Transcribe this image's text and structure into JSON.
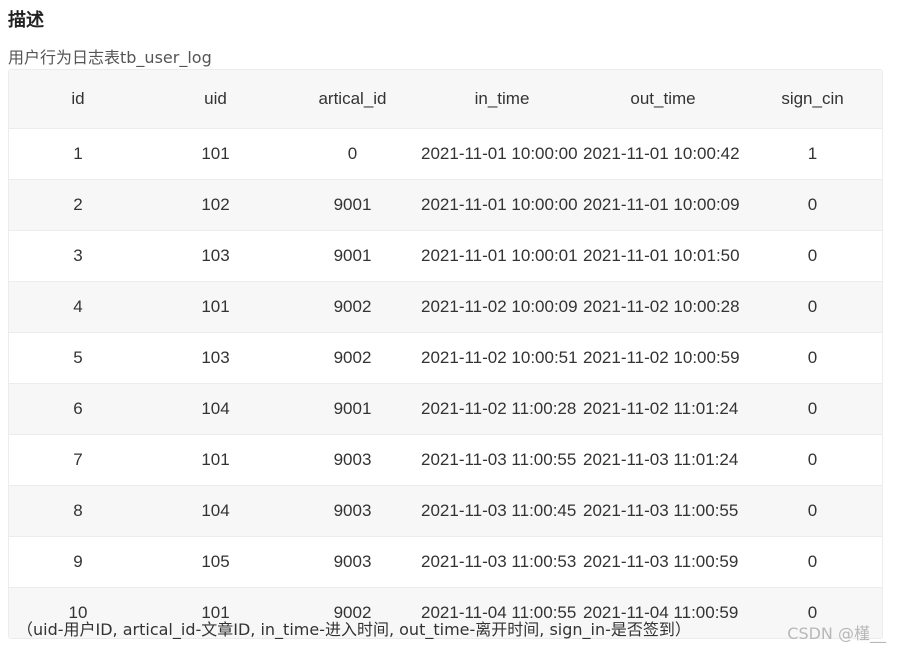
{
  "heading": "描述",
  "subtitle": "用户行为日志表tb_user_log",
  "table": {
    "columns": [
      "id",
      "uid",
      "artical_id",
      "in_time",
      "out_time",
      "sign_cin"
    ],
    "rows": [
      [
        "1",
        "101",
        "0",
        "2021-11-01 10:00:00",
        "2021-11-01 10:00:42",
        "1"
      ],
      [
        "2",
        "102",
        "9001",
        "2021-11-01 10:00:00",
        "2021-11-01 10:00:09",
        "0"
      ],
      [
        "3",
        "103",
        "9001",
        "2021-11-01 10:00:01",
        "2021-11-01 10:01:50",
        "0"
      ],
      [
        "4",
        "101",
        "9002",
        "2021-11-02 10:00:09",
        "2021-11-02 10:00:28",
        "0"
      ],
      [
        "5",
        "103",
        "9002",
        "2021-11-02 10:00:51",
        "2021-11-02 10:00:59",
        "0"
      ],
      [
        "6",
        "104",
        "9001",
        "2021-11-02 11:00:28",
        "2021-11-02 11:01:24",
        "0"
      ],
      [
        "7",
        "101",
        "9003",
        "2021-11-03 11:00:55",
        "2021-11-03 11:01:24",
        "0"
      ],
      [
        "8",
        "104",
        "9003",
        "2021-11-03 11:00:45",
        "2021-11-03 11:00:55",
        "0"
      ],
      [
        "9",
        "105",
        "9003",
        "2021-11-03 11:00:53",
        "2021-11-03 11:00:59",
        "0"
      ],
      [
        "10",
        "101",
        "9002",
        "2021-11-04 11:00:55",
        "2021-11-04 11:00:59",
        "0"
      ]
    ]
  },
  "footnote": "（uid-用户ID, artical_id-文章ID, in_time-进入时间, out_time-离开时间, sign_in-是否签到）",
  "watermark": "CSDN @槿__"
}
